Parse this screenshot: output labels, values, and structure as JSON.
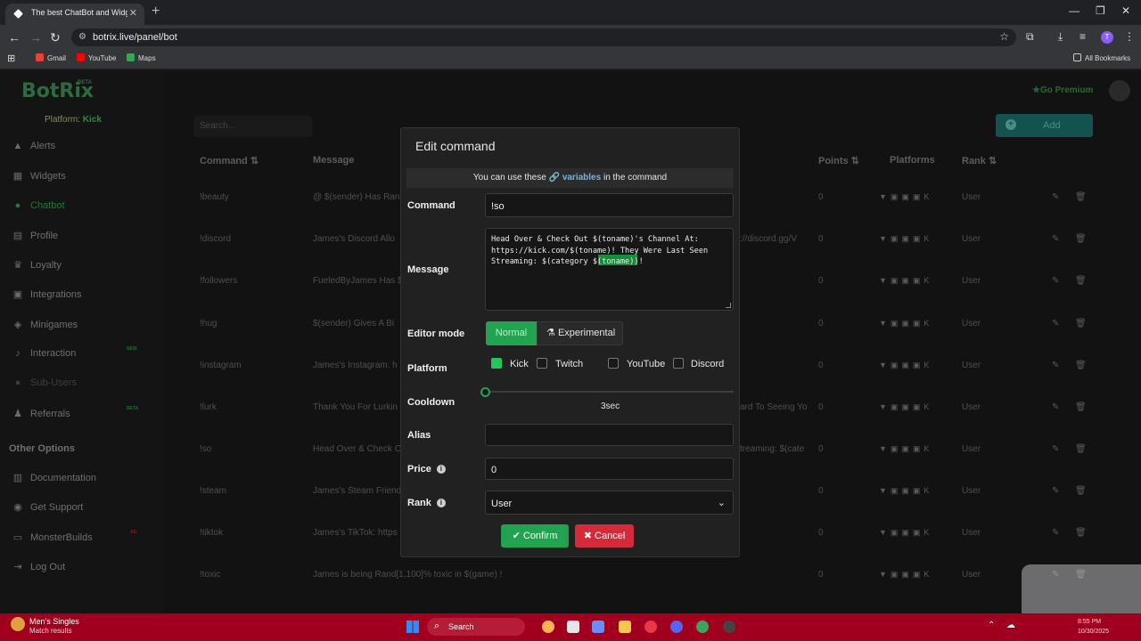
{
  "browser": {
    "tab_title": "The best ChatBot and Widgets",
    "tab_close": "✕",
    "new_tab": "+",
    "url": "botrix.live/panel/bot",
    "bookmarks": [
      {
        "label": "Gmail",
        "color": "#ea4335"
      },
      {
        "label": "YouTube",
        "color": "#ff0000"
      },
      {
        "label": "Maps",
        "color": "#34a853"
      }
    ],
    "all_bookmarks": "All Bookmarks",
    "profile_initial": "T"
  },
  "app": {
    "logo": "BotRix",
    "logo_badge": "BETA",
    "platform_label": "Platform:",
    "platform_value": "Kick",
    "go_premium": "Go Premium",
    "search_placeholder": "Search...",
    "add_button": "Add",
    "nav": [
      {
        "label": "Alerts",
        "icon": "warning-icon"
      },
      {
        "label": "Widgets",
        "icon": "widgets-icon"
      },
      {
        "label": "Chatbot",
        "icon": "chatbot-icon",
        "active": true
      },
      {
        "label": "Profile",
        "icon": "profile-icon"
      },
      {
        "label": "Loyalty",
        "icon": "trophy-icon"
      },
      {
        "label": "Integrations",
        "icon": "integrations-icon"
      },
      {
        "label": "Minigames",
        "icon": "gamepad-icon"
      },
      {
        "label": "Interaction",
        "icon": "music-icon",
        "badge": "NEW"
      },
      {
        "label": "Sub-Users",
        "icon": "users-icon",
        "disabled": true
      },
      {
        "label": "Referrals",
        "icon": "referrals-icon",
        "badge": "BETA"
      }
    ],
    "other_options_heading": "Other Options",
    "other_nav": [
      {
        "label": "Documentation",
        "icon": "docs-icon"
      },
      {
        "label": "Get Support",
        "icon": "support-icon"
      },
      {
        "label": "MonsterBuilds",
        "icon": "monitor-icon",
        "badge": "AD"
      },
      {
        "label": "Log Out",
        "icon": "logout-icon"
      }
    ],
    "table": {
      "headers": {
        "command": "Command",
        "message": "Message",
        "points": "Points",
        "platforms": "Platforms",
        "rank": "Rank"
      },
      "rows": [
        {
          "command": "!beauty",
          "message": "@ $(sender) Has Ran",
          "message_right": "",
          "points": "0",
          "rank": "User"
        },
        {
          "command": "!discord",
          "message": "James's Discord Allo",
          "message_right": "://discord.gg/V",
          "points": "0",
          "rank": "User"
        },
        {
          "command": "!followers",
          "message": "FueledByJames Has $",
          "message_right": "",
          "points": "0",
          "rank": "User"
        },
        {
          "command": "!hug",
          "message": "$(sender) Gives A Bi",
          "message_right": "",
          "points": "0",
          "rank": "User"
        },
        {
          "command": "!instagram",
          "message": "James's Instagram: h",
          "message_right": "",
          "points": "0",
          "rank": "User"
        },
        {
          "command": "!lurk",
          "message": "Thank You For Lurkin",
          "message_right": "ard To Seeing Yo",
          "points": "0",
          "rank": "User"
        },
        {
          "command": "!so",
          "message": "Head Over & Check C",
          "message_right": "treaming: $(cate",
          "points": "0",
          "rank": "User"
        },
        {
          "command": "!steam",
          "message": "James's Steam Friend",
          "message_right": "",
          "points": "0",
          "rank": "User"
        },
        {
          "command": "!tiktok",
          "message": "James's TikTok: https",
          "message_right": "",
          "points": "0",
          "rank": "User"
        },
        {
          "command": "!toxic",
          "message": "James is being Rand[1,100]% toxic in $(game) !",
          "message_right": "",
          "points": "0",
          "rank": "User"
        }
      ]
    }
  },
  "modal": {
    "title": "Edit command",
    "variables_prefix": "You can use these",
    "variables_link": "variables",
    "variables_suffix": "in the command",
    "command_label": "Command",
    "command_value": "!so",
    "message_label": "Message",
    "message_value": "Head Over & Check Out $(toname)'s Channel At: https://kick.com/$(toname)! They Were Last Seen Streaming: $(category $(toname))!",
    "editor_mode_label": "Editor mode",
    "mode_normal": "Normal",
    "mode_experimental": "Experimental",
    "platform_label": "Platform",
    "platforms": [
      {
        "label": "Kick",
        "checked": true
      },
      {
        "label": "Twitch",
        "checked": false
      },
      {
        "label": "YouTube",
        "checked": false
      },
      {
        "label": "Discord",
        "checked": false
      }
    ],
    "cooldown_label": "Cooldown",
    "cooldown_value": "3sec",
    "cooldown_fraction": 0.0,
    "alias_label": "Alias",
    "alias_value": "",
    "price_label": "Price",
    "price_value": "0",
    "rank_label": "Rank",
    "rank_value": "User",
    "confirm": "Confirm",
    "cancel": "Cancel"
  },
  "taskbar": {
    "news_title": "Men's Singles",
    "news_sub": "Match results",
    "search": "Search",
    "time": "8:55 PM",
    "date": "10/30/2025"
  }
}
